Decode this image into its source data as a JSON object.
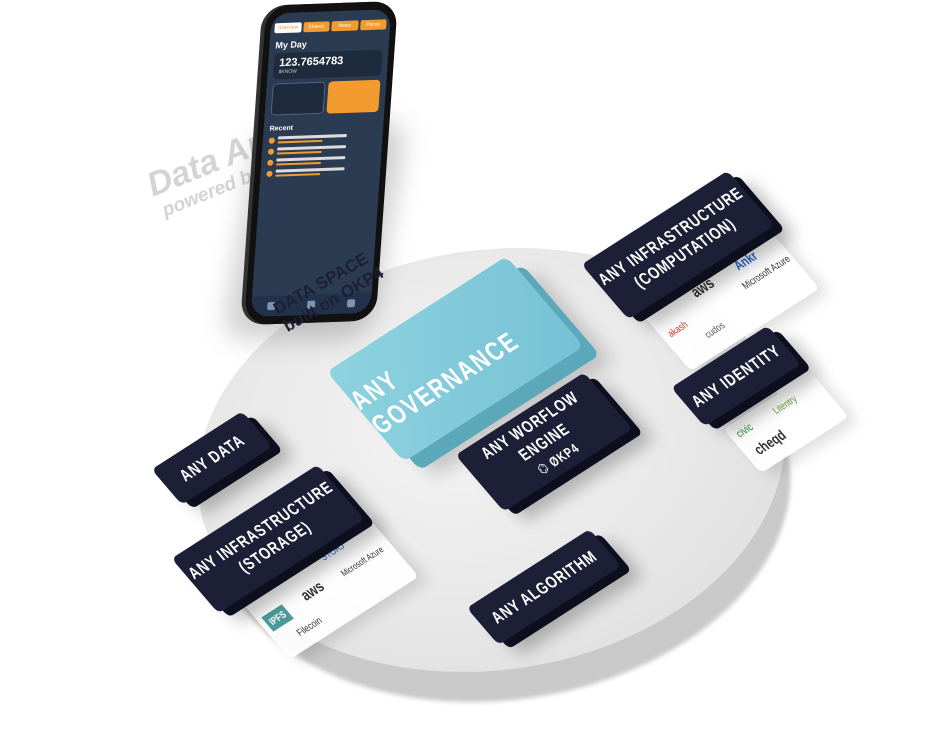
{
  "phone_app": {
    "tabs": [
      "Overview",
      "Shares",
      "News",
      "Prices"
    ],
    "heading": "My Day",
    "balance_value": "123.7654783",
    "balance_unit": "$KNOW",
    "recent_heading": "Recent"
  },
  "data_app": {
    "title": "Data App",
    "subtitle": "powered by OKP4"
  },
  "data_space": {
    "line1": "DATA SPACE",
    "line2": "built on OKP4"
  },
  "governance": {
    "label": "ANY GOVERNANCE"
  },
  "workflow": {
    "line1": "ANY WORFLOW",
    "line2": "ENGINE",
    "brand": "⌬ ØKP4"
  },
  "any_data": {
    "label": "ANY DATA"
  },
  "any_algorithm": {
    "label": "ANY ALGORITHM"
  },
  "infra_storage": {
    "line1": "ANY INFRASTRUCTURE",
    "line2": "(STORAGE)",
    "logos": [
      "STORJ",
      "IPFS",
      "aws",
      "Microsoft Azure",
      "Filecoin"
    ]
  },
  "infra_computation": {
    "line1": "ANY INFRASTRUCTURE",
    "line2": "(COMPUTATION)",
    "logos": [
      "aws",
      "Ankr",
      "akash",
      "Microsoft Azure",
      "cudos"
    ]
  },
  "identity": {
    "label": "ANY IDENTITY",
    "logos": [
      "civic",
      "Litentry",
      "cheqd"
    ]
  },
  "colors": {
    "navy": "#1d1f36",
    "teal": "#7ecada",
    "orange": "#f39b2f",
    "platform": "#e3e3e3"
  }
}
